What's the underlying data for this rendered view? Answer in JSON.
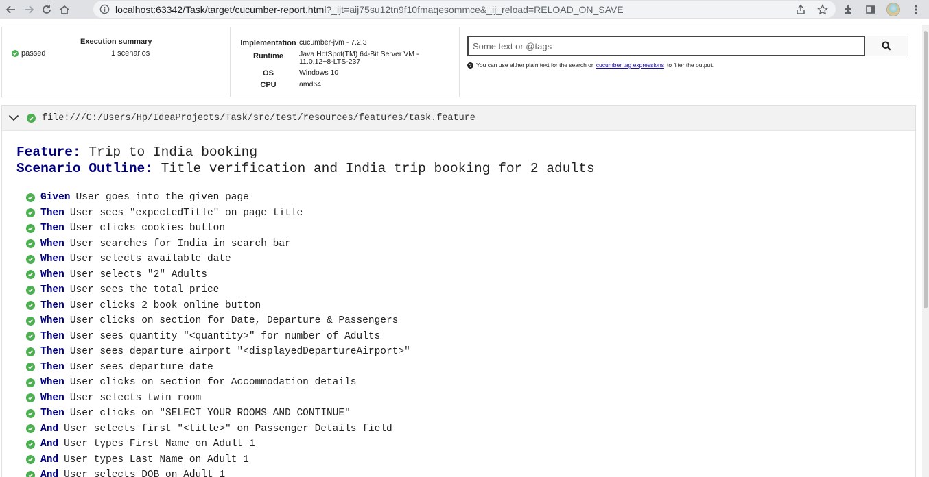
{
  "browser": {
    "url_main": "localhost:63342/Task/target/cucumber-report.html",
    "url_query": "?_ijt=aij75su12tn9f10fmaqesommce&_ij_reload=RELOAD_ON_SAVE"
  },
  "summary": {
    "title": "Execution summary",
    "status": "passed",
    "scenarios": "1 scenarios",
    "env": [
      {
        "key": "Implementation",
        "value": "cucumber-jvm - 7.2.3"
      },
      {
        "key": "Runtime",
        "value": "Java HotSpot(TM) 64-Bit Server VM - 11.0.12+8-LTS-237"
      },
      {
        "key": "OS",
        "value": "Windows 10"
      },
      {
        "key": "CPU",
        "value": "amd64"
      }
    ]
  },
  "search": {
    "placeholder": "Some text or @tags",
    "help_prefix": "You can use either plain text for the search or",
    "help_link": "cucumber tag expressions",
    "help_suffix": "to filter the output."
  },
  "feature": {
    "path": "file:///C:/Users/Hp/IdeaProjects/Task/src/test/resources/features/task.feature",
    "feature_kw": "Feature:",
    "feature_name": "Trip to India booking",
    "scenario_kw": "Scenario Outline:",
    "scenario_name": "Title verification and India trip booking for 2 adults"
  },
  "steps": [
    {
      "kw": "Given",
      "text": "User goes into the given page"
    },
    {
      "kw": "Then",
      "text": "User sees \"expectedTitle\" on page title"
    },
    {
      "kw": "Then",
      "text": "User clicks cookies button"
    },
    {
      "kw": "When",
      "text": "User searches for India in search bar"
    },
    {
      "kw": "When",
      "text": "User selects available date"
    },
    {
      "kw": "When",
      "text": "User selects \"2\" Adults"
    },
    {
      "kw": "Then",
      "text": "User sees the total price"
    },
    {
      "kw": "Then",
      "text": "User clicks 2 book online button"
    },
    {
      "kw": "When",
      "text": "User clicks on section for Date, Departure & Passengers"
    },
    {
      "kw": "Then",
      "text": "User sees quantity \"<quantity>\" for number of Adults"
    },
    {
      "kw": "Then",
      "text": "User sees departure airport \"<displayedDepartureAirport>\""
    },
    {
      "kw": "Then",
      "text": "User sees departure date"
    },
    {
      "kw": "When",
      "text": "User clicks on section for Accommodation details"
    },
    {
      "kw": "When",
      "text": "User selects twin room"
    },
    {
      "kw": "Then",
      "text": "User clicks on \"SELECT YOUR ROOMS AND CONTINUE\""
    },
    {
      "kw": "And",
      "text": "User selects first \"<title>\" on Passenger Details field"
    },
    {
      "kw": "And",
      "text": "User types First Name on Adult 1"
    },
    {
      "kw": "And",
      "text": "User types Last Name on Adult 1"
    },
    {
      "kw": "And",
      "text": "User selects DOB on Adult 1"
    }
  ]
}
